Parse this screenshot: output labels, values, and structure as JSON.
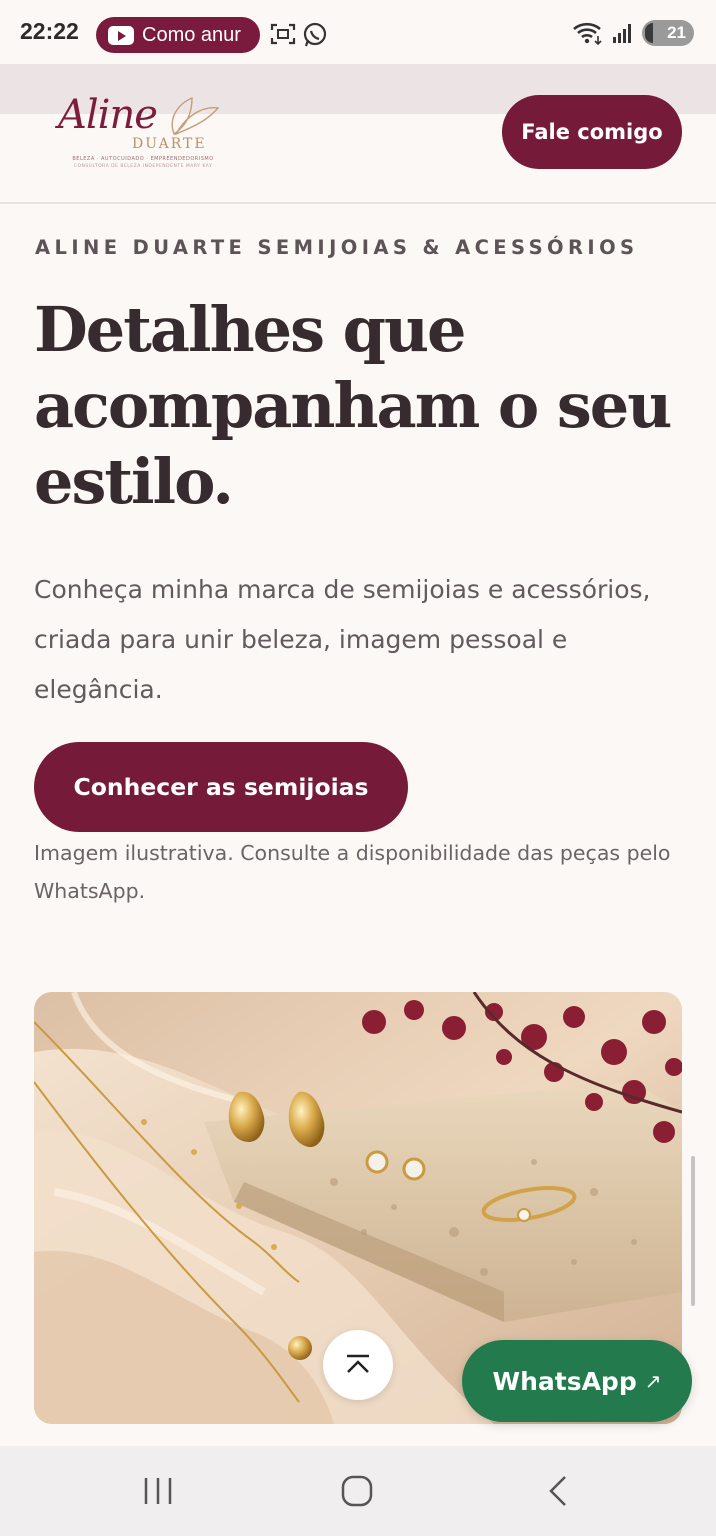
{
  "status_bar": {
    "time": "22:22",
    "notification_pill": "Como anur",
    "battery": "21"
  },
  "header": {
    "logo": {
      "script": "Aline",
      "name": "DUARTE",
      "tagline": "BELEZA · AUTOCUIDADO · EMPREENDEDORISMO",
      "subline": "CONSULTORA DE BELEZA INDEPENDENTE MARY KAY"
    },
    "contact_button": "Fale comigo"
  },
  "hero": {
    "eyebrow": "ALINE DUARTE SEMIJOIAS & ACESSÓRIOS",
    "headline": "Detalhes que acompanham o seu estilo.",
    "lead": "Conheça minha marca de semijoias e acessórios, criada para unir beleza, imagem pessoal e elegância.",
    "cta": "Conhecer as semijoias",
    "disclaimer": "Imagem ilustrativa. Consulte a disponibilidade das peças pelo WhatsApp."
  },
  "floating": {
    "whatsapp_label": "WhatsApp",
    "whatsapp_arrow": "↗",
    "back_to_top_icon": "chevron-up-bar-icon"
  },
  "colors": {
    "brand": "#761a3a",
    "whatsapp": "#237a4c",
    "background": "#fcf8f5"
  },
  "navigation_bar": {
    "icons": [
      "recents-icon",
      "home-icon",
      "back-icon"
    ]
  }
}
